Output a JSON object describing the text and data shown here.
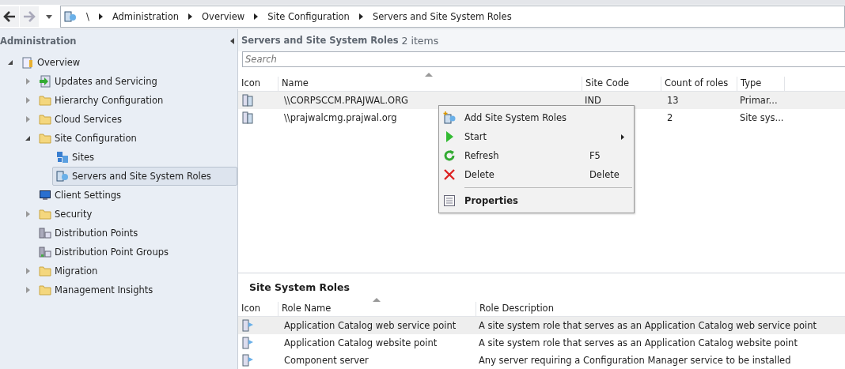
{
  "breadcrumb": [
    "\\",
    "Administration",
    "Overview",
    "Site Configuration",
    "Servers and Site System Roles"
  ],
  "sidebar": {
    "title": "Administration",
    "tree": [
      {
        "label": "Overview",
        "kind": "overview",
        "expanded": true,
        "selected": false,
        "children": [
          {
            "label": "Updates and Servicing",
            "kind": "updates",
            "expanded": false,
            "selected": false
          },
          {
            "label": "Hierarchy Configuration",
            "kind": "folder",
            "expanded": false,
            "selected": false
          },
          {
            "label": "Cloud Services",
            "kind": "folder",
            "expanded": false,
            "selected": false
          },
          {
            "label": "Site Configuration",
            "kind": "folder",
            "expanded": true,
            "selected": false,
            "children": [
              {
                "label": "Sites",
                "kind": "sites",
                "selected": false
              },
              {
                "label": "Servers and Site System Roles",
                "kind": "servers",
                "selected": true
              }
            ]
          },
          {
            "label": "Client Settings",
            "kind": "client",
            "selected": false
          },
          {
            "label": "Security",
            "kind": "folder",
            "expanded": false,
            "selected": false
          },
          {
            "label": "Distribution Points",
            "kind": "dp",
            "selected": false
          },
          {
            "label": "Distribution Point Groups",
            "kind": "dpgroup",
            "selected": false
          },
          {
            "label": "Migration",
            "kind": "folder",
            "expanded": false,
            "selected": false
          },
          {
            "label": "Management Insights",
            "kind": "folder",
            "expanded": false,
            "selected": false
          }
        ]
      }
    ]
  },
  "list": {
    "title": "Servers and Site System Roles",
    "count": "2 items",
    "search": {
      "placeholder": "Search"
    },
    "columns": [
      "Icon",
      "Name",
      "Site Code",
      "Count of roles",
      "Type"
    ],
    "rows": [
      {
        "name": "\\\\CORPSCCM.PRAJWAL.ORG",
        "site_code": "IND",
        "count": "13",
        "type": "Primar...",
        "selected": true
      },
      {
        "name": "\\\\prajwalcmg.prajwal.org",
        "count": "2",
        "type": "Site sys...",
        "selected": false
      }
    ]
  },
  "context_menu": [
    {
      "kind": "add",
      "label": "Add Site System Roles",
      "default": false
    },
    {
      "kind": "start",
      "label": "Start",
      "submenu": true,
      "default": false
    },
    {
      "kind": "refresh",
      "label": "Refresh",
      "shortcut": "F5",
      "default": false
    },
    {
      "kind": "delete",
      "label": "Delete",
      "shortcut": "Delete",
      "default": false
    },
    {
      "kind": "separator"
    },
    {
      "kind": "properties",
      "label": "Properties",
      "default": true
    }
  ],
  "details": {
    "title": "Site System Roles",
    "columns": [
      "Icon",
      "Role Name",
      "Role Description"
    ],
    "rows": [
      {
        "name": "Application Catalog web service point",
        "description": "A site system role that serves as an Application Catalog web service point",
        "selected": true
      },
      {
        "name": "Application Catalog website point",
        "description": "A site system role that serves as an Application Catalog website point",
        "selected": false
      },
      {
        "name": "Component server",
        "description": "Any server requiring a Configuration Manager service to be installed",
        "selected": false
      }
    ]
  }
}
